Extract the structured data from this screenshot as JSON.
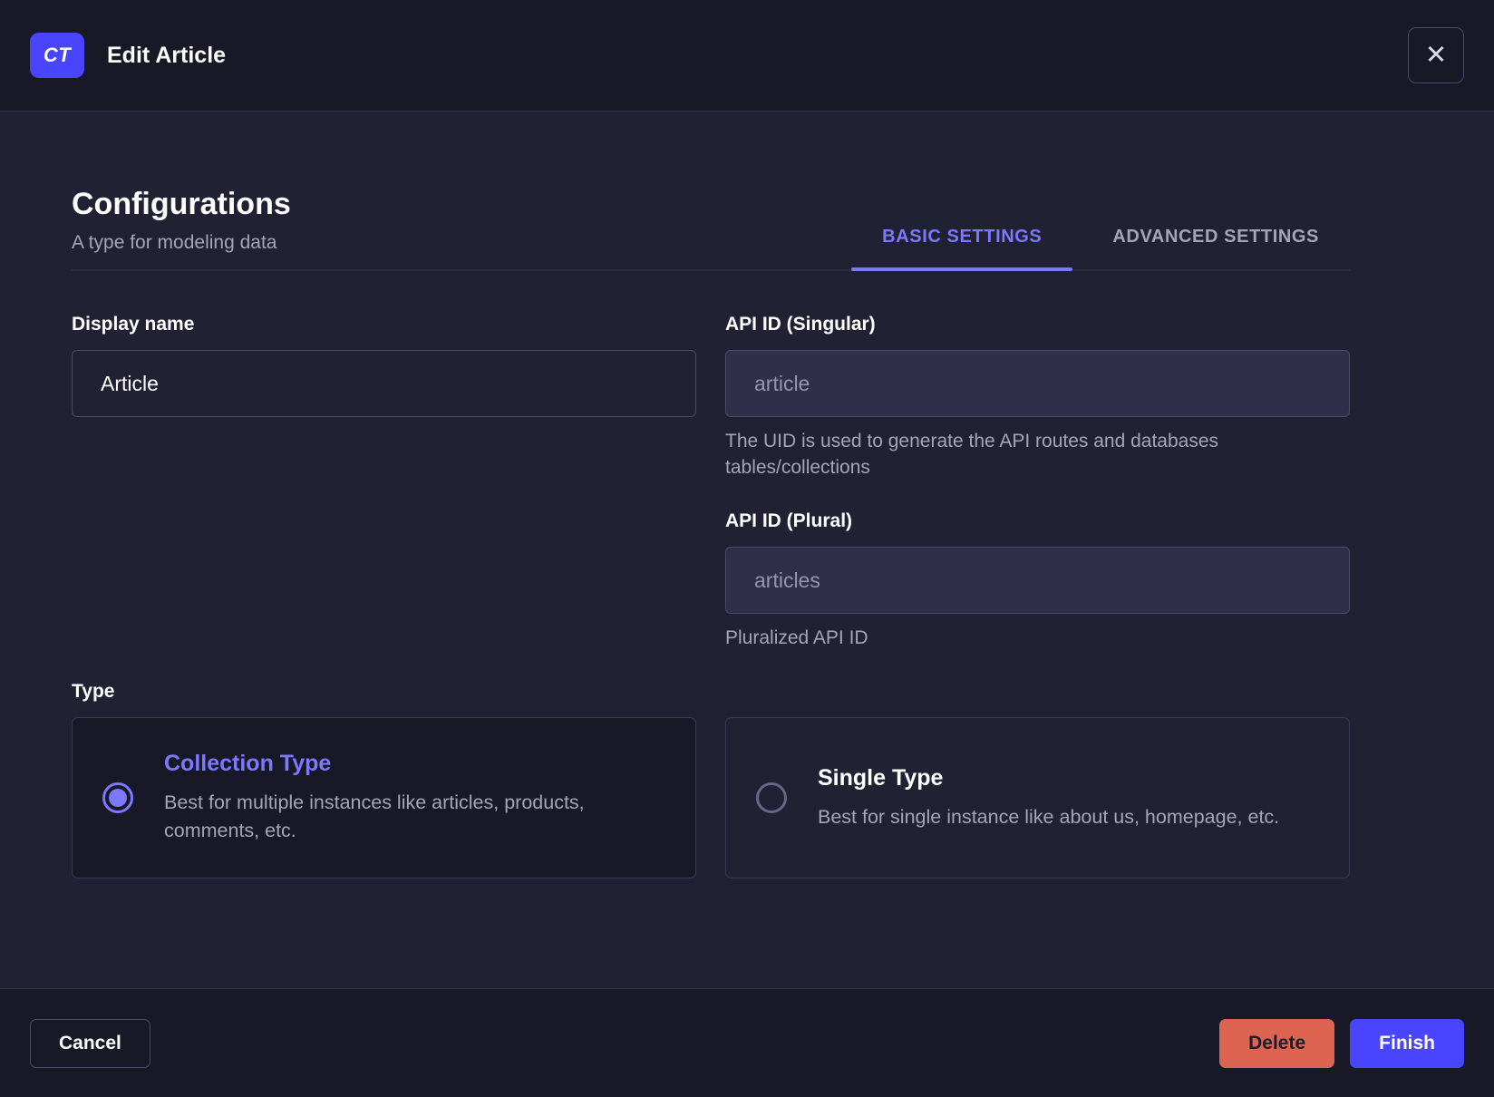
{
  "header": {
    "badge": "CT",
    "title": "Edit Article",
    "close_icon": "✕"
  },
  "configurations": {
    "title": "Configurations",
    "subtitle": "A type for modeling data"
  },
  "tabs": [
    {
      "label": "BASIC SETTINGS",
      "active": true
    },
    {
      "label": "ADVANCED SETTINGS",
      "active": false
    }
  ],
  "form": {
    "display_name": {
      "label": "Display name",
      "value": "Article"
    },
    "api_id_singular": {
      "label": "API ID (Singular)",
      "value": "article",
      "hint": "The UID is used to generate the API routes and databases tables/collections"
    },
    "api_id_plural": {
      "label": "API ID (Plural)",
      "value": "articles",
      "hint": "Pluralized API ID"
    }
  },
  "type_section": {
    "label": "Type",
    "options": [
      {
        "title": "Collection Type",
        "description": "Best for multiple instances like articles, products, comments, etc.",
        "selected": true
      },
      {
        "title": "Single Type",
        "description": "Best for single instance like about us, homepage, etc.",
        "selected": false
      }
    ]
  },
  "footer": {
    "cancel_label": "Cancel",
    "delete_label": "Delete",
    "finish_label": "Finish"
  },
  "colors": {
    "primary": "#4945ff",
    "primary_light": "#7b79ff",
    "danger": "#dc6450",
    "header_bg": "#181826",
    "body_bg": "#212134",
    "muted_text": "#a5a5ba"
  }
}
